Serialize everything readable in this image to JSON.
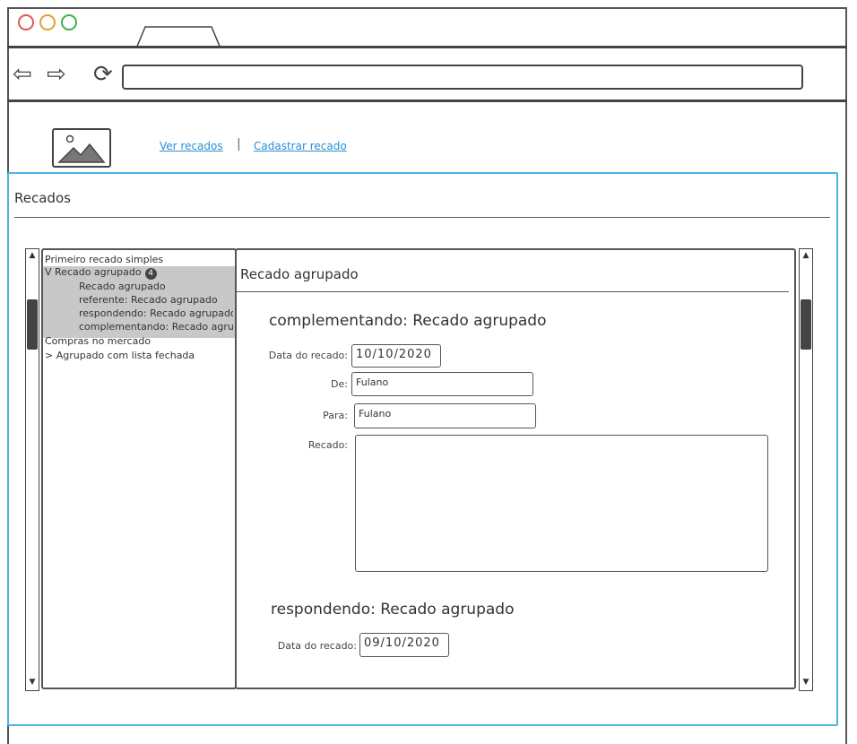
{
  "browser": {
    "dots": [
      "#e05555",
      "#e0a030",
      "#3cb34a"
    ],
    "back_glyph": "⇦",
    "forward_glyph": "⇨",
    "reload_glyph": "⟳",
    "url": ""
  },
  "header": {
    "links": {
      "ver_recados": "Ver recados",
      "cadastrar_recado": "Cadastrar recado"
    },
    "separator": "|"
  },
  "panel": {
    "title": "Recados"
  },
  "tree": {
    "items": [
      {
        "text": "Primeiro recado simples"
      },
      {
        "text": "V Recado agrupado",
        "badge": "4"
      },
      {
        "text": "Recado agrupado"
      },
      {
        "text": "referente: Recado agrupado"
      },
      {
        "text": "respondendo: Recado agrupado"
      },
      {
        "text": "complementando: Recado agrupado"
      },
      {
        "text": "Compras no mercado"
      },
      {
        "text": "> Agrupado com lista fechada"
      }
    ]
  },
  "detail": {
    "title": "Recado agrupado",
    "sections": [
      {
        "heading": "complementando: Recado agrupado",
        "date_label": "Data do recado:",
        "date_value": "10/10/2020",
        "de_label": "De:",
        "de_value": "Fulano",
        "para_label": "Para:",
        "para_value": "Fulano",
        "recado_label": "Recado:",
        "recado_value": ""
      },
      {
        "heading": "respondendo: Recado agrupado",
        "date_label": "Data do recado:",
        "date_value": "09/10/2020"
      }
    ]
  },
  "scroll": {
    "up_glyph": "▲",
    "down_glyph": "▼"
  }
}
